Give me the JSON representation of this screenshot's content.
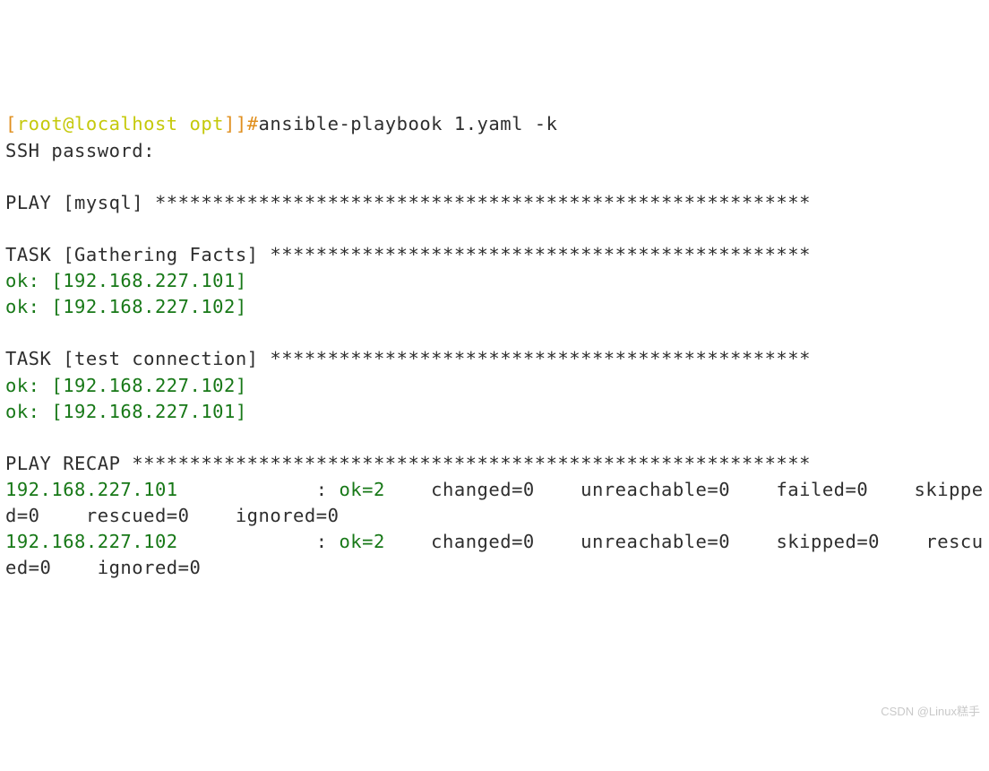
{
  "prompt": {
    "lbracket": "[",
    "userhost": "root@localhost opt",
    "rbracket": "]]#",
    "command": "ansible-playbook 1.yaml -k"
  },
  "ssh_prompt": "SSH password:",
  "blank": "",
  "play_header": "PLAY [mysql] *********************************************************",
  "task1_header": "TASK [Gathering Facts] ***********************************************",
  "task1_ok1": "ok: [192.168.227.101]",
  "task1_ok2": "ok: [192.168.227.102]",
  "task2_header": "TASK [test connection] ***********************************************",
  "task2_ok1": "ok: [192.168.227.102]",
  "task2_ok2": "ok: [192.168.227.101]",
  "recap_header": "PLAY RECAP ***********************************************************",
  "recap1_host": "192.168.227.101",
  "recap1_pad": "            : ",
  "recap1_ok": "ok=2   ",
  "recap1_rest": " changed=0    unreachable=0    failed=0    skipped=0    rescued=0    ignored=0   ",
  "recap2_host": "192.168.227.102",
  "recap2_pad": "            : ",
  "recap2_ok": "ok=2   ",
  "recap2_rest": " changed=0    unreachable=0    skipped=0    rescued=0    ignored=0   ",
  "watermark": "CSDN @Linux糕手"
}
